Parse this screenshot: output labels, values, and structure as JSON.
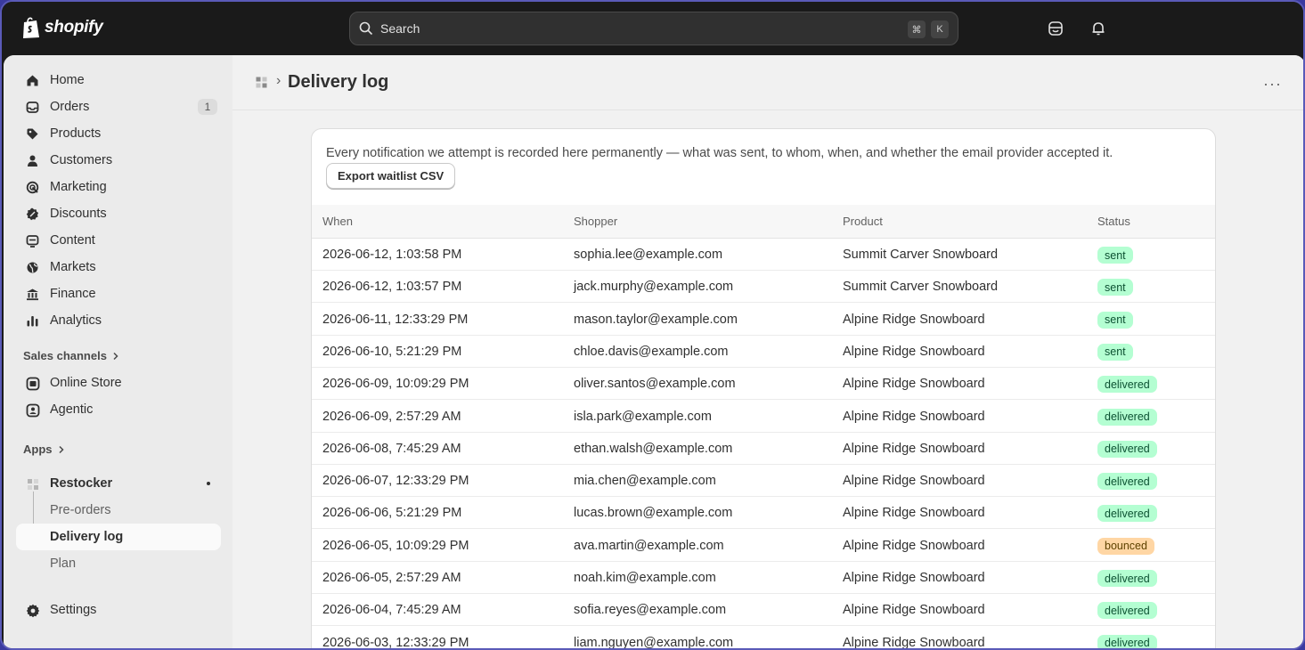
{
  "brand": {
    "name": "shopify"
  },
  "search": {
    "placeholder": "Search",
    "shortcut_mod": "⌘",
    "shortcut_key": "K"
  },
  "topbar_icons": [
    "store-icon",
    "bell-icon"
  ],
  "sidebar": {
    "items": [
      {
        "label": "Home",
        "icon": "home-icon"
      },
      {
        "label": "Orders",
        "icon": "orders-icon",
        "badge": "1"
      },
      {
        "label": "Products",
        "icon": "tag-icon"
      },
      {
        "label": "Customers",
        "icon": "person-icon"
      },
      {
        "label": "Marketing",
        "icon": "target-icon"
      },
      {
        "label": "Discounts",
        "icon": "discount-icon"
      },
      {
        "label": "Content",
        "icon": "content-icon"
      },
      {
        "label": "Markets",
        "icon": "globe-icon"
      },
      {
        "label": "Finance",
        "icon": "bank-icon"
      },
      {
        "label": "Analytics",
        "icon": "chart-icon"
      }
    ],
    "sales_channels_label": "Sales channels",
    "channels": [
      {
        "label": "Online Store",
        "icon": "store-icon"
      },
      {
        "label": "Agentic",
        "icon": "agent-icon"
      }
    ],
    "apps_label": "Apps",
    "app": {
      "label": "Restocker",
      "subitems": [
        {
          "label": "Pre-orders"
        },
        {
          "label": "Delivery log",
          "active": true
        },
        {
          "label": "Plan"
        }
      ]
    },
    "settings_label": "Settings"
  },
  "page": {
    "breadcrumb_sep": "›",
    "title": "Delivery log",
    "more": "···"
  },
  "card": {
    "description": "Every notification we attempt is recorded here permanently — what was sent, to whom, when, and whether the email provider accepted it.",
    "export_label": "Export waitlist CSV"
  },
  "table": {
    "headers": [
      "When",
      "Shopper",
      "Product",
      "Status"
    ],
    "rows": [
      {
        "when": "2026-06-12, 1:03:58 PM",
        "shopper": "sophia.lee@example.com",
        "product": "Summit Carver Snowboard",
        "status": "sent"
      },
      {
        "when": "2026-06-12, 1:03:57 PM",
        "shopper": "jack.murphy@example.com",
        "product": "Summit Carver Snowboard",
        "status": "sent"
      },
      {
        "when": "2026-06-11, 12:33:29 PM",
        "shopper": "mason.taylor@example.com",
        "product": "Alpine Ridge Snowboard",
        "status": "sent"
      },
      {
        "when": "2026-06-10, 5:21:29 PM",
        "shopper": "chloe.davis@example.com",
        "product": "Alpine Ridge Snowboard",
        "status": "sent"
      },
      {
        "when": "2026-06-09, 10:09:29 PM",
        "shopper": "oliver.santos@example.com",
        "product": "Alpine Ridge Snowboard",
        "status": "delivered"
      },
      {
        "when": "2026-06-09, 2:57:29 AM",
        "shopper": "isla.park@example.com",
        "product": "Alpine Ridge Snowboard",
        "status": "delivered"
      },
      {
        "when": "2026-06-08, 7:45:29 AM",
        "shopper": "ethan.walsh@example.com",
        "product": "Alpine Ridge Snowboard",
        "status": "delivered"
      },
      {
        "when": "2026-06-07, 12:33:29 PM",
        "shopper": "mia.chen@example.com",
        "product": "Alpine Ridge Snowboard",
        "status": "delivered"
      },
      {
        "when": "2026-06-06, 5:21:29 PM",
        "shopper": "lucas.brown@example.com",
        "product": "Alpine Ridge Snowboard",
        "status": "delivered"
      },
      {
        "when": "2026-06-05, 10:09:29 PM",
        "shopper": "ava.martin@example.com",
        "product": "Alpine Ridge Snowboard",
        "status": "bounced"
      },
      {
        "when": "2026-06-05, 2:57:29 AM",
        "shopper": "noah.kim@example.com",
        "product": "Alpine Ridge Snowboard",
        "status": "delivered"
      },
      {
        "when": "2026-06-04, 7:45:29 AM",
        "shopper": "sofia.reyes@example.com",
        "product": "Alpine Ridge Snowboard",
        "status": "delivered"
      },
      {
        "when": "2026-06-03, 12:33:29 PM",
        "shopper": "liam.nguyen@example.com",
        "product": "Alpine Ridge Snowboard",
        "status": "delivered"
      }
    ]
  },
  "colors": {
    "topbar": "#1a1a1a",
    "status_sent_bg": "#b4fed2",
    "status_delivered_bg": "#b4fed2",
    "status_bounced_bg": "#ffd6a4"
  }
}
